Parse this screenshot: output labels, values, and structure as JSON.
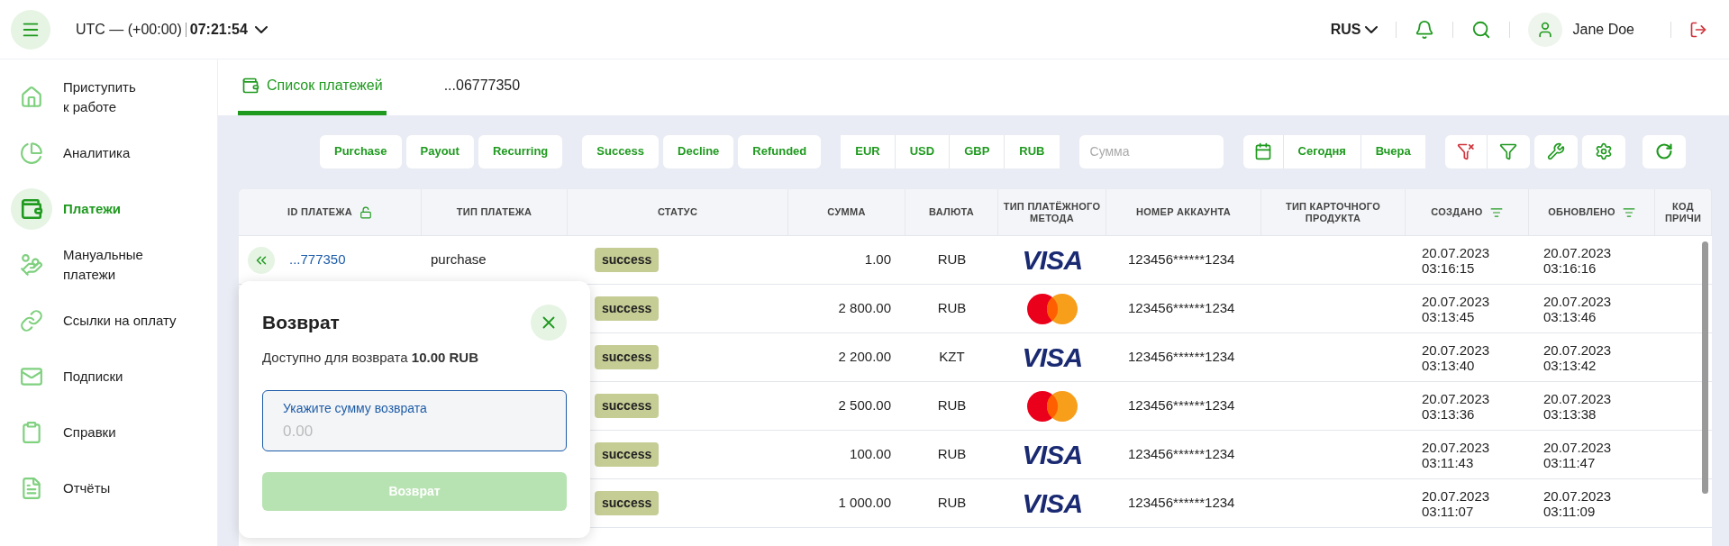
{
  "header": {
    "timezone": "UTC — (+00:00)",
    "time": "07:21:54",
    "language": "RUS",
    "user": "Jane Doe"
  },
  "sidebar": {
    "items": [
      {
        "label": "Приступить\nк работе",
        "selected": false
      },
      {
        "label": "Аналитика",
        "selected": false
      },
      {
        "label": "Платежи",
        "selected": true
      },
      {
        "label": "Мануальные\nплатежи",
        "selected": false
      },
      {
        "label": "Ссылки на оплату",
        "selected": false
      },
      {
        "label": "Подписки",
        "selected": false
      },
      {
        "label": "Справки",
        "selected": false
      },
      {
        "label": "Отчёты",
        "selected": false
      }
    ]
  },
  "tabs": [
    {
      "label": "Список платежей",
      "selected": true
    },
    {
      "label": "...06777350",
      "selected": false
    }
  ],
  "filters": {
    "type_buttons": [
      "Purchase",
      "Payout",
      "Recurring"
    ],
    "status_buttons": [
      "Success",
      "Decline",
      "Refunded"
    ],
    "currency_buttons": [
      "EUR",
      "USD",
      "GBP",
      "RUB"
    ],
    "amount_placeholder": "Сумма",
    "date_buttons": [
      "Сегодня",
      "Вчера"
    ]
  },
  "table": {
    "columns": [
      {
        "label": "ID ПЛАТЕЖА",
        "kind": "lock"
      },
      {
        "label": "ТИП ПЛАТЕЖА",
        "kind": "plain"
      },
      {
        "label": "СТАТУС",
        "kind": "plain"
      },
      {
        "label": "СУММА",
        "kind": "plain"
      },
      {
        "label": "ВАЛЮТА",
        "kind": "plain"
      },
      {
        "label": "ТИП ПЛАТЁЖНОГО МЕТОДА",
        "kind": "plain"
      },
      {
        "label": "НОМЕР АККАУНТА",
        "kind": "plain"
      },
      {
        "label": "ТИП КАРТОЧНОГО ПРОДУКТА",
        "kind": "plain"
      },
      {
        "label": "СОЗДАНО",
        "kind": "sort"
      },
      {
        "label": "ОБНОВЛЕНО",
        "kind": "sort"
      },
      {
        "label": "КОД ПРИЧИ",
        "kind": "plain"
      }
    ],
    "rows": [
      {
        "id": "...777350",
        "type": "purchase",
        "status": "success",
        "amount": "1.00",
        "currency": "RUB",
        "method": {
          "kind": "visa",
          "label": "VISA"
        },
        "account": "123456******1234",
        "created": [
          "20.07.2023",
          "03:16:15"
        ],
        "updated": [
          "20.07.2023",
          "03:16:16"
        ]
      },
      {
        "status": "success",
        "amount": "2 800.00",
        "currency": "RUB",
        "method": {
          "kind": "mastercard"
        },
        "account": "123456******1234",
        "created": [
          "20.07.2023",
          "03:13:45"
        ],
        "updated": [
          "20.07.2023",
          "03:13:46"
        ]
      },
      {
        "status": "success",
        "amount": "2 200.00",
        "currency": "KZT",
        "method": {
          "kind": "visa",
          "label": "VISA"
        },
        "account": "123456******1234",
        "created": [
          "20.07.2023",
          "03:13:40"
        ],
        "updated": [
          "20.07.2023",
          "03:13:42"
        ]
      },
      {
        "status": "success",
        "amount": "2 500.00",
        "currency": "RUB",
        "method": {
          "kind": "mastercard"
        },
        "account": "123456******1234",
        "created": [
          "20.07.2023",
          "03:13:36"
        ],
        "updated": [
          "20.07.2023",
          "03:13:38"
        ]
      },
      {
        "status": "success",
        "amount": "100.00",
        "currency": "RUB",
        "method": {
          "kind": "visa",
          "label": "VISA"
        },
        "account": "123456******1234",
        "created": [
          "20.07.2023",
          "03:11:43"
        ],
        "updated": [
          "20.07.2023",
          "03:11:47"
        ]
      },
      {
        "status": "success",
        "amount": "1 000.00",
        "currency": "RUB",
        "method": {
          "kind": "visa",
          "label": "VISA"
        },
        "account": "123456******1234",
        "created": [
          "20.07.2023",
          "03:11:07"
        ],
        "updated": [
          "20.07.2023",
          "03:11:09"
        ]
      }
    ]
  },
  "refund_dialog": {
    "title": "Возврат",
    "available": "Доступно для возврата **10.00 RUB**",
    "field_label": "Укажите сумму возврата",
    "placeholder": "0.00",
    "submit": "Возврат",
    "submit_disabled": true
  }
}
